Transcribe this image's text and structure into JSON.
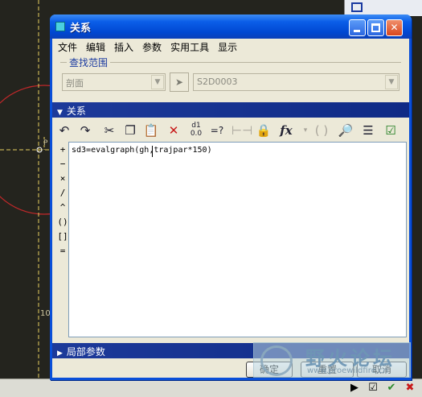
{
  "cad": {
    "label_p": "P",
    "label_10": "10",
    "bottom_tools": [
      "▶",
      "☑",
      "✔",
      "✖"
    ]
  },
  "dialog": {
    "title": "关系",
    "menus": [
      "文件",
      "编辑",
      "插入",
      "参数",
      "实用工具",
      "显示"
    ],
    "search_range_label": "查找范围",
    "section_combo_value": "剖面",
    "feature_combo_value": "S2D0003",
    "relations_band_label": "关系",
    "toolbar_icons": [
      "undo-icon",
      "redo-icon",
      "cut-icon",
      "copy-icon",
      "paste-icon",
      "delete-icon",
      "evaluate-icon",
      "insert-comparison-icon",
      "units-icon",
      "show-dims-icon",
      "function-icon",
      "parentheses-icon",
      "verify-icon",
      "sort-icon",
      "check-icon"
    ],
    "tool_labels": {
      "eval_top": "d1",
      "eval_bottom": "0.0",
      "eq_query": "=?",
      "function": "fx"
    },
    "operators": [
      "+",
      "−",
      "×",
      "/",
      "^",
      "()",
      "[]",
      "="
    ],
    "relation_text": "sd3=evalgraph(gh,trajpar*150)",
    "local_params_label": "局部参数",
    "buttons": {
      "ok": "确定",
      "reset": "重置",
      "cancel": "取消"
    }
  },
  "watermark": {
    "text": "野火论坛",
    "url": "www.proewildfire.cn"
  },
  "colors": {
    "titlebar": "#0b5ee8",
    "band": "#1d3a9a",
    "dialog_bg": "#ece9d8",
    "cad_bg": "#24241e"
  }
}
